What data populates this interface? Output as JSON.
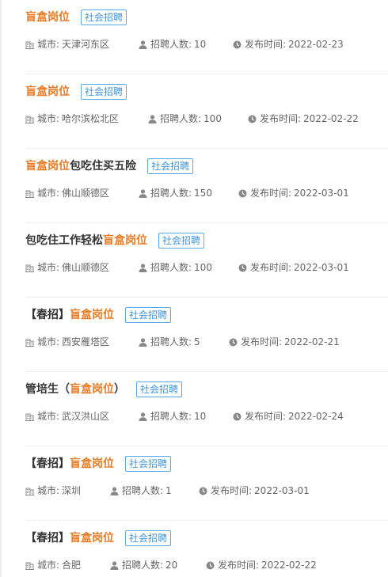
{
  "labels": {
    "city": "城市:",
    "count": "招聘人数:",
    "date": "发布时间:"
  },
  "jobs": [
    {
      "title": [
        {
          "t": "盲盒岗位",
          "hl": true
        }
      ],
      "tag": "社会招聘",
      "city": "天津河东区",
      "count": "10",
      "date": "2022-02-23"
    },
    {
      "title": [
        {
          "t": "盲盒岗位",
          "hl": true
        }
      ],
      "tag": "社会招聘",
      "city": "哈尔滨松北区",
      "count": "100",
      "date": "2022-02-22"
    },
    {
      "title": [
        {
          "t": "盲盒岗位",
          "hl": true
        },
        {
          "t": "包吃住买五险",
          "hl": false
        }
      ],
      "tag": "社会招聘",
      "city": "佛山顺德区",
      "count": "150",
      "date": "2022-03-01"
    },
    {
      "title": [
        {
          "t": "包吃住工作轻松",
          "hl": false
        },
        {
          "t": "盲盒岗位",
          "hl": true
        }
      ],
      "tag": "社会招聘",
      "city": "佛山顺德区",
      "count": "100",
      "date": "2022-03-01"
    },
    {
      "title": [
        {
          "t": "【春招】",
          "hl": false
        },
        {
          "t": "盲盒岗位",
          "hl": true
        }
      ],
      "tag": "社会招聘",
      "city": "西安雁塔区",
      "count": "5",
      "date": "2022-02-21"
    },
    {
      "title": [
        {
          "t": "管培生（",
          "hl": false
        },
        {
          "t": "盲盒岗位",
          "hl": true
        },
        {
          "t": "）",
          "hl": false
        }
      ],
      "tag": "社会招聘",
      "city": "武汉洪山区",
      "count": "10",
      "date": "2022-02-24"
    },
    {
      "title": [
        {
          "t": "【春招】",
          "hl": false
        },
        {
          "t": "盲盒岗位",
          "hl": true
        }
      ],
      "tag": "社会招聘",
      "city": "深圳",
      "count": "1",
      "date": "2022-03-01"
    },
    {
      "title": [
        {
          "t": "【春招】",
          "hl": false
        },
        {
          "t": "盲盒岗位",
          "hl": true
        }
      ],
      "tag": "社会招聘",
      "city": "合肥",
      "count": "20",
      "date": "2022-02-22"
    }
  ],
  "colors": {
    "highlight": "#e87b26",
    "tag": "#3f95dc",
    "meta": "#666666"
  },
  "icons": {
    "city": "building-icon",
    "count": "person-icon",
    "date": "clock-icon"
  }
}
